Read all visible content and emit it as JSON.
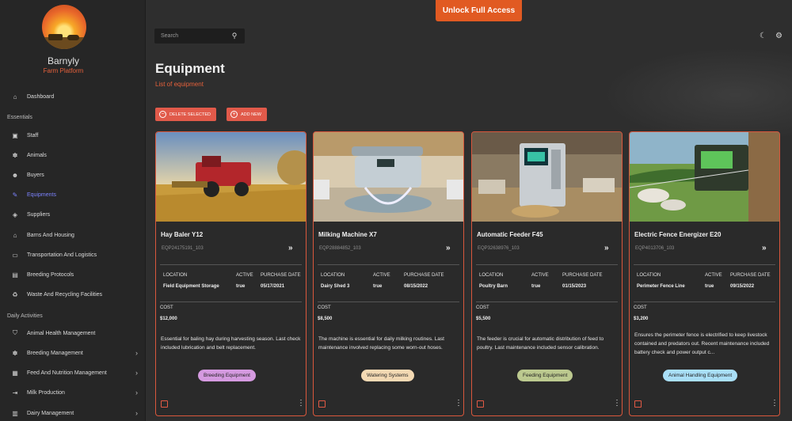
{
  "app": {
    "name": "Barnyly",
    "subtitle": "Farm Platform",
    "unlock_label": "Unlock Full Access"
  },
  "search": {
    "placeholder": "Search"
  },
  "sidebar": {
    "top_item": {
      "label": "Dashboard",
      "icon": "home-icon"
    },
    "sections": [
      {
        "label": "Essentials"
      },
      {
        "label": "Daily Activities"
      }
    ],
    "essentials": [
      {
        "label": "Staff",
        "icon": "staff-icon"
      },
      {
        "label": "Animals",
        "icon": "paw-icon"
      },
      {
        "label": "Buyers",
        "icon": "users-icon"
      },
      {
        "label": "Equipments",
        "icon": "wrench-icon",
        "active": true
      },
      {
        "label": "Suppliers",
        "icon": "handshake-icon"
      },
      {
        "label": "Barns And Housing",
        "icon": "barn-icon"
      },
      {
        "label": "Transportation And Logistics",
        "icon": "truck-icon"
      },
      {
        "label": "Breeding Protocols",
        "icon": "clipboard-icon"
      },
      {
        "label": "Waste And Recycling Facilities",
        "icon": "recycle-icon"
      }
    ],
    "daily": [
      {
        "label": "Animal Health Management",
        "icon": "health-icon",
        "expandable": false
      },
      {
        "label": "Breeding Management",
        "icon": "paw-icon",
        "expandable": true
      },
      {
        "label": "Feed And Nutrition Management",
        "icon": "feed-icon",
        "expandable": true
      },
      {
        "label": "Milk Production",
        "icon": "milk-icon",
        "expandable": true
      },
      {
        "label": "Dairy Management",
        "icon": "dairy-icon",
        "expandable": true
      }
    ]
  },
  "page": {
    "title": "Equipment",
    "subtitle": "List of equipment",
    "delete_label": "DELETE SELECTED",
    "add_label": "ADD NEW"
  },
  "field_labels": {
    "location": "LOCATION",
    "active": "ACTIVE",
    "purchase_date": "PURCHASE DATE",
    "cost": "COST"
  },
  "cards": [
    {
      "title": "Hay Baler Y12",
      "code": "EQP24175191_103",
      "location": "Field Equipment Storage",
      "active": "true",
      "purchase_date": "05/17/2021",
      "cost": "$12,000",
      "description": "Essential for baling hay during harvesting season. Last check included lubrication and belt replacement.",
      "tag": "Breeding Equipment",
      "tag_color": "#d59ae0"
    },
    {
      "title": "Milking Machine X7",
      "code": "EQP28884852_103",
      "location": "Dairy Shed 3",
      "active": "true",
      "purchase_date": "08/15/2022",
      "cost": "$8,500",
      "description": "The machine is essential for daily milking routines. Last maintenance involved replacing some worn-out hoses.",
      "tag": "Watering Systems",
      "tag_color": "#f3d9b3"
    },
    {
      "title": "Automatic Feeder F45",
      "code": "EQP32638976_103",
      "location": "Poultry Barn",
      "active": "true",
      "purchase_date": "01/15/2023",
      "cost": "$5,500",
      "description": "The feeder is crucial for automatic distribution of feed to poultry. Last maintenance included sensor calibration.",
      "tag": "Feeding Equipment",
      "tag_color": "#bcc98f"
    },
    {
      "title": "Electric Fence Energizer E20",
      "code": "EQP4013706_103",
      "location": "Perimeter Fence Line",
      "active": "true",
      "purchase_date": "09/15/2022",
      "cost": "$3,200",
      "description": "Ensures the perimeter fence is electrified to keep livestock contained and predators out. Recent maintenance included battery check and power output c...",
      "tag": "Animal Handling Equipment",
      "tag_color": "#a9dff7"
    }
  ]
}
